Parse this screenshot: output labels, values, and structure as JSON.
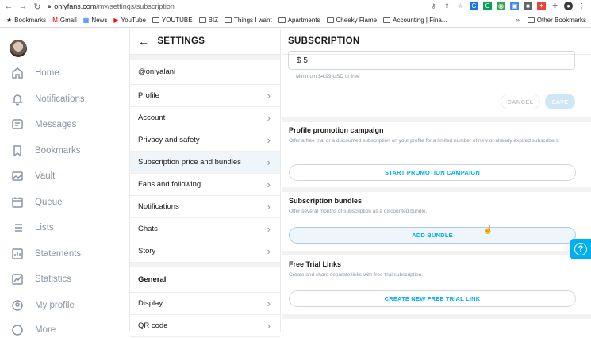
{
  "browser": {
    "url_host": "onlyfans.com",
    "url_path": "/my/settings/subscription",
    "bookmarks": [
      "Bookmarks",
      "Gmail",
      "News",
      "YouTube",
      "YOUTUBE",
      "BIZ",
      "Things I want",
      "Apartments",
      "Cheeky Flame",
      "Accounting | Fina..."
    ],
    "more": "»",
    "other_bookmarks": "Other Bookmarks"
  },
  "nav": {
    "items": [
      "Home",
      "Notifications",
      "Messages",
      "Bookmarks",
      "Vault",
      "Queue",
      "Lists",
      "Statements",
      "Statistics",
      "My profile",
      "More"
    ]
  },
  "settings": {
    "title": "SETTINGS",
    "username": "@onlyalani",
    "items": [
      "Profile",
      "Account",
      "Privacy and safety",
      "Subscription price and bundles",
      "Fans and following",
      "Notifications",
      "Chats",
      "Story"
    ],
    "section_general": "General",
    "general_items": [
      "Display",
      "QR code"
    ]
  },
  "subscription": {
    "title": "SUBSCRIPTION",
    "price_value": "$ 5",
    "price_hint": "Minimum $4.99 USD or free",
    "cancel": "CANCEL",
    "save": "SAVE",
    "promo_title": "Profile promotion campaign",
    "promo_desc": "Offer a free trial or a discounted subscription on your profile for a limited number of new or already expired subscribers.",
    "promo_button": "START PROMOTION CAMPAIGN",
    "bundles_title": "Subscription bundles",
    "bundles_desc": "Offer several months of subscription as a discounted bundle.",
    "bundles_button": "ADD BUNDLE",
    "trial_title": "Free Trial Links",
    "trial_desc": "Create and share separate links with free trial subscription.",
    "trial_button": "CREATE NEW FREE TRIAL LINK"
  },
  "colors": {
    "accent": "#00aff0",
    "muted": "#8a96a3"
  }
}
